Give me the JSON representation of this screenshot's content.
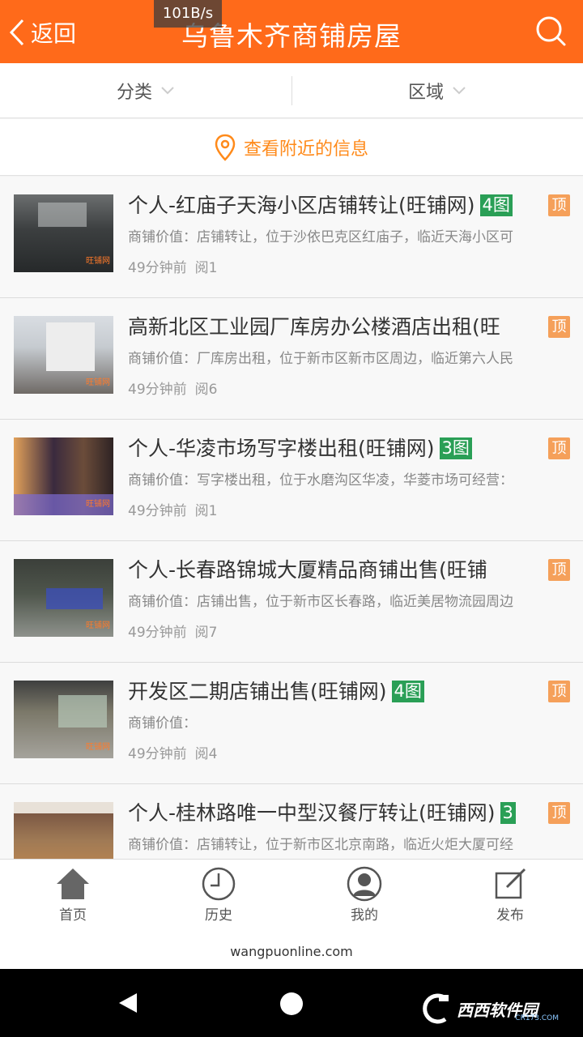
{
  "status": {
    "net_speed": "101B/s"
  },
  "header": {
    "back_label": "返回",
    "title": "乌鲁木齐商铺房屋",
    "search_icon": "search-icon",
    "color": "#ff6a1a"
  },
  "filters": [
    {
      "label": "分类"
    },
    {
      "label": "区域"
    }
  ],
  "nearby": {
    "label": "查看附近的信息"
  },
  "listings": [
    {
      "title": "个人-红庙子天海小区店铺转让(旺铺网)",
      "images": "4图",
      "top": "顶",
      "desc": "商铺价值：店铺转让，位于沙依巴克区红庙子，临近天海小区可",
      "time": "49分钟前",
      "views": "阅1"
    },
    {
      "title": "高新北区工业园厂库房办公楼酒店出租(旺",
      "images": "",
      "top": "顶",
      "desc": "商铺价值：厂库房出租，位于新市区新市区周边，临近第六人民",
      "time": "49分钟前",
      "views": "阅6"
    },
    {
      "title": "个人-华凌市场写字楼出租(旺铺网)",
      "images": "3图",
      "top": "顶",
      "desc": "商铺价值：写字楼出租，位于水磨沟区华凌，华菱市场可经营：",
      "time": "49分钟前",
      "views": "阅1"
    },
    {
      "title": "个人-长春路锦城大厦精品商铺出售(旺铺",
      "images": "",
      "top": "顶",
      "desc": "商铺价值：店铺出售，位于新市区长春路，临近美居物流园周边",
      "time": "49分钟前",
      "views": "阅7"
    },
    {
      "title": "开发区二期店铺出售(旺铺网)",
      "images": "4图",
      "top": "顶",
      "desc": "商铺价值：",
      "time": "49分钟前",
      "views": "阅4"
    },
    {
      "title": "个人-桂林路唯一中型汉餐厅转让(旺铺网)",
      "images": "3",
      "top": "顶",
      "desc": "商铺价值：店铺转让，位于新市区北京南路，临近火炬大厦可经",
      "time": "",
      "views": ""
    }
  ],
  "thumb_watermark": "旺铺网",
  "tabs": [
    {
      "label": "首页",
      "icon": "home-icon"
    },
    {
      "label": "历史",
      "icon": "clock-icon"
    },
    {
      "label": "我的",
      "icon": "user-icon"
    },
    {
      "label": "发布",
      "icon": "edit-icon"
    }
  ],
  "footer": {
    "domain": "wangpuonline.com"
  },
  "watermark": {
    "brand": "西西软件园",
    "sub": "CR173.COM"
  }
}
